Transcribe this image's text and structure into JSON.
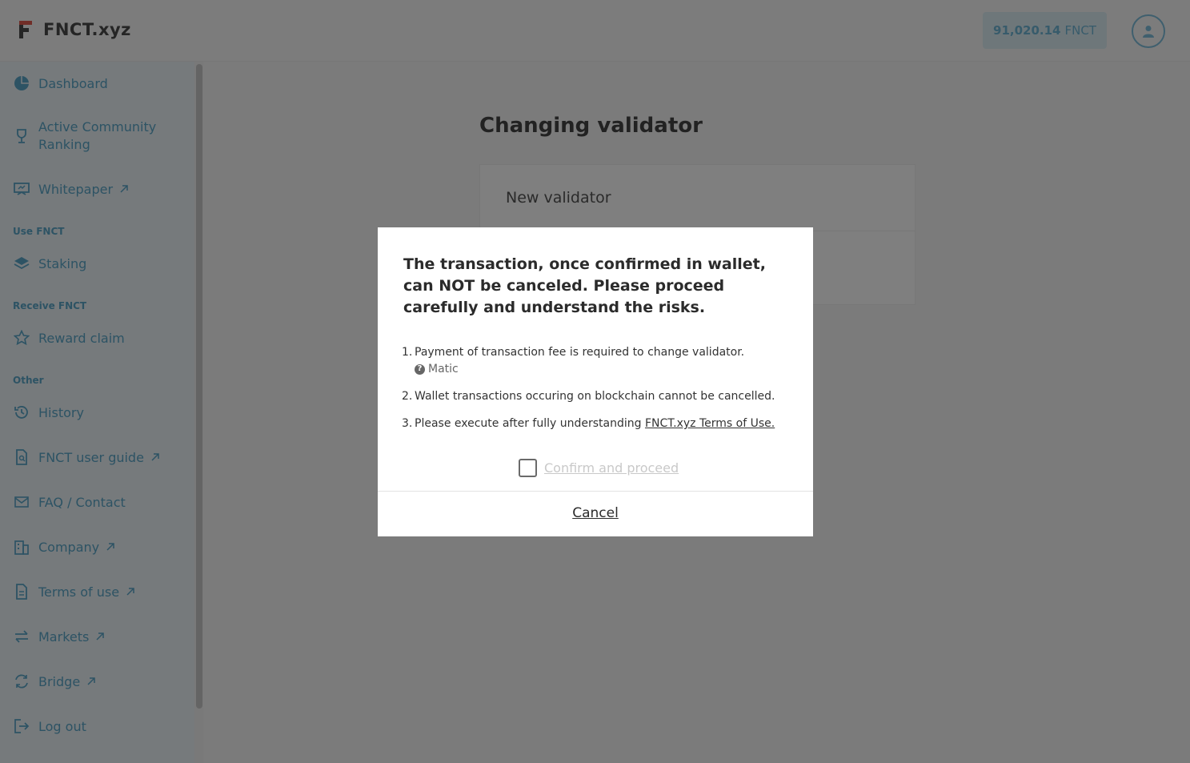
{
  "header": {
    "brand": "FNCT.xyz",
    "balance_value": "91,020.14",
    "balance_unit": "FNCT",
    "accent_color": "#5aa6c9"
  },
  "sidebar": {
    "items": [
      {
        "label": "Dashboard",
        "icon": "pie-chart-icon"
      },
      {
        "label": "Active Community Ranking",
        "icon": "trophy-icon"
      },
      {
        "label": "Whitepaper",
        "icon": "presentation-icon",
        "external": true
      },
      {
        "label": "Staking",
        "icon": "layers-icon"
      },
      {
        "label": "Reward claim",
        "icon": "star-icon"
      },
      {
        "label": "History",
        "icon": "history-icon"
      },
      {
        "label": "FNCT user guide",
        "icon": "document-search-icon",
        "external": true
      },
      {
        "label": "FAQ / Contact",
        "icon": "mail-icon"
      },
      {
        "label": "Company",
        "icon": "building-icon",
        "external": true
      },
      {
        "label": "Terms of use",
        "icon": "document-icon",
        "external": true
      },
      {
        "label": "Markets",
        "icon": "exchange-icon",
        "external": true
      },
      {
        "label": "Bridge",
        "icon": "bridge-icon",
        "external": true
      },
      {
        "label": "Log out",
        "icon": "logout-icon"
      }
    ],
    "sections": {
      "use": "Use FNCT",
      "receive": "Receive FNCT",
      "other": "Other"
    }
  },
  "main": {
    "title": "Changing validator",
    "card_heading": "New validator"
  },
  "modal": {
    "title": "The transaction, once confirmed in wallet, can NOT be canceled. Please proceed carefully and understand the risks.",
    "items": [
      {
        "num": "1.",
        "text": "Payment of transaction fee is required to change validator.",
        "sub": "Matic"
      },
      {
        "num": "2.",
        "text": "Wallet transactions occuring on blockchain cannot be cancelled."
      },
      {
        "num": "3.",
        "text": "Please execute after fully understanding ",
        "link": "FNCT.xyz Terms of Use."
      }
    ],
    "confirm_label": "Confirm and proceed",
    "confirm_checked": false,
    "cancel_label": "Cancel"
  }
}
